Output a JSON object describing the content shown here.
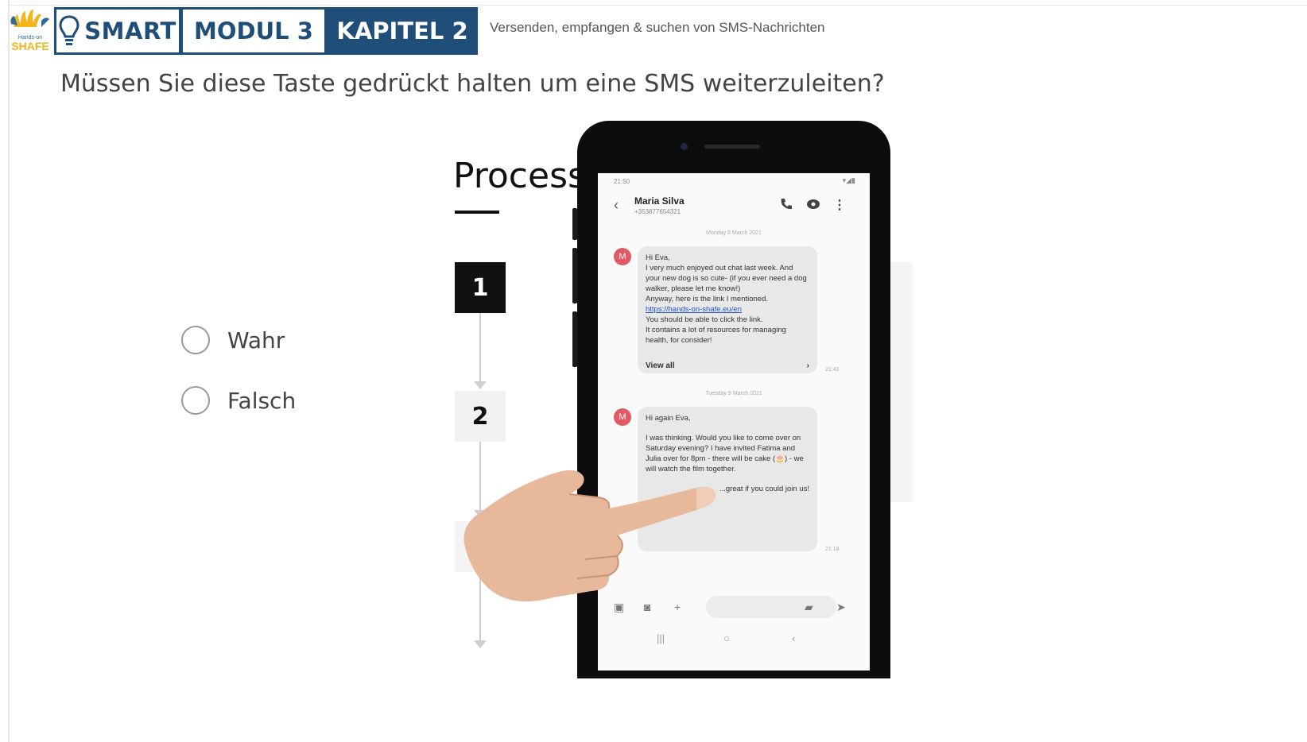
{
  "header": {
    "logo_text": "Hands-on SHAFE",
    "brand_label": "SMART",
    "module_label": "MODUL 3",
    "chapter_label": "KAPITEL 2",
    "subtitle": "Versenden, empfangen & suchen von SMS-Nachrichten"
  },
  "quiz": {
    "question": "Müssen Sie diese Taste gedrückt halten um eine SMS weiterzuleiten?",
    "options": [
      {
        "label": "Wahr",
        "selected": false
      },
      {
        "label": "Falsch",
        "selected": false
      }
    ]
  },
  "illustration": {
    "title": "Process",
    "steps": [
      "1",
      "2"
    ],
    "phone": {
      "status_time": "21:50",
      "contact_name": "Maria Silva",
      "contact_number": "+353877654321",
      "date_1": "Monday 8 March 2021",
      "message_1": {
        "avatar": "M",
        "lines": [
          "Hi Eva,",
          "I very much enjoyed out chat last week. And your new dog is so cute- (if you ever need a dog walker, please let me know!)",
          "Anyway, here is the link I mentioned."
        ],
        "link": "https://hands-on-shafe.eu/en",
        "after_link": [
          "You should be able to click the link.",
          "It contains a lot of resources for managing health, for consider!"
        ],
        "view_all": "View all",
        "time": "21:42"
      },
      "date_2": "Tuesday 9 March 2021",
      "message_2": {
        "avatar": "M",
        "greeting": "Hi again Eva,",
        "body": "I was thinking. Would you like to come over on Saturday evening? I have invited Fatima and Julia over for 8pm - there will be cake (🎂) - we will watch the film together.",
        "closing": "...great if you could join us!",
        "time": "21:18"
      }
    }
  },
  "colors": {
    "brand_blue": "#1f4e79",
    "avatar_red": "#e05a63"
  }
}
